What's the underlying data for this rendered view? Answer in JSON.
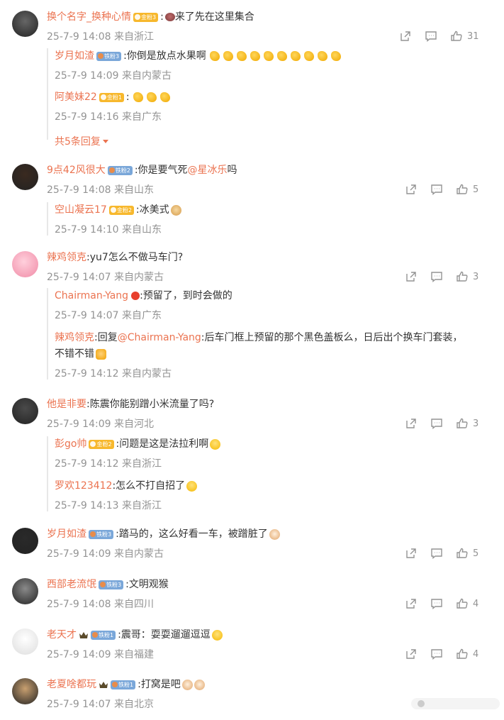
{
  "comments": [
    {
      "user": "换个名字_换种心情",
      "badge": {
        "type": "gold",
        "label": "金粉3"
      },
      "text": "来了先在这里集合",
      "prefix_emoji": "squirrel",
      "suffix_emojis": [],
      "meta": "25-7-9 14:08 来自浙江",
      "likes": "31",
      "avatar_color": "#666",
      "replies": [
        {
          "user": "岁月如渣",
          "badge": {
            "type": "iron",
            "label": "铁粉3"
          },
          "text": "你倒是放点水果啊",
          "suffix_emojis": [
            "banana",
            "banana",
            "banana",
            "banana",
            "banana",
            "banana",
            "banana",
            "banana",
            "banana",
            "banana"
          ],
          "meta": "25-7-9 14:09 来自内蒙古"
        },
        {
          "user": "阿美妹22",
          "badge": {
            "type": "gold",
            "label": "金粉1"
          },
          "text": "",
          "suffix_emojis": [
            "banana",
            "banana",
            "banana"
          ],
          "meta": "25-7-9 14:16 来自广东"
        }
      ],
      "more": "共5条回复"
    },
    {
      "user": "9点42风很大",
      "badge": {
        "type": "iron",
        "label": "铁粉2"
      },
      "text": "你是要气死",
      "mention": "@星冰乐",
      "text_after": " 吗",
      "meta": "25-7-9 14:08 来自山东",
      "likes": "5",
      "avatar_color": "#3a2a20",
      "replies": [
        {
          "user": "空山凝云17",
          "badge": {
            "type": "gold",
            "label": "金粉2"
          },
          "text": "冰美式",
          "suffix_emojis": [
            "dog"
          ],
          "meta": "25-7-9 14:10 来自山东"
        }
      ]
    },
    {
      "user": "辣鸡领克",
      "text": "yu7怎么不做马车门?",
      "meta": "25-7-9 14:07 来自内蒙古",
      "likes": "3",
      "avatar_color": "#f6b6c8",
      "replies": [
        {
          "user": "Chairman-Yang",
          "verified": true,
          "text": "预留了，到时会做的",
          "meta": "25-7-9 14:07 来自广东"
        },
        {
          "user": "辣鸡领克",
          "text": "回复",
          "mention": "@Chairman-Yang",
          "text_after": ":后车门框上预留的那个黑色盖板么，日后出个换车门套装，",
          "text_line2": "不错不错",
          "suffix_emojis": [
            "thumb"
          ],
          "meta": "25-7-9 14:12 来自内蒙古"
        }
      ]
    },
    {
      "user": "他是非要",
      "text": "陈震你能别蹭小米流量了吗?",
      "meta": "25-7-9 14:09 来自河北",
      "likes": "3",
      "avatar_color": "#4a4a4a",
      "replies": [
        {
          "user": "彭go帅",
          "badge": {
            "type": "gold",
            "label": "金粉2"
          },
          "text": "问题是这是法拉利啊",
          "suffix_emojis": [
            "laugh"
          ],
          "meta": "25-7-9 14:12 来自浙江"
        },
        {
          "user": "罗欢123412",
          "text": "怎么不打自招了",
          "suffix_emojis": [
            "laugh"
          ],
          "meta": "25-7-9 14:13 来自浙江"
        }
      ]
    },
    {
      "user": "岁月如渣",
      "badge": {
        "type": "iron",
        "label": "铁粉3"
      },
      "text": "踏马的，这么好看一车，被蹭脏了",
      "suffix_emojis": [
        "cat"
      ],
      "meta": "25-7-9 14:09 来自内蒙古",
      "likes": "5",
      "avatar_color": "#2a2a2a",
      "replies": []
    },
    {
      "user": "西部老流氓",
      "badge": {
        "type": "iron",
        "label": "铁粉3"
      },
      "text": "文明观猴",
      "meta": "25-7-9 14:08 来自四川",
      "likes": "4",
      "avatar_color": "#8a8a8a",
      "replies": []
    },
    {
      "user": "老天才",
      "crown": true,
      "badge": {
        "type": "iron",
        "label": "铁粉1"
      },
      "text": "震哥：耍耍遛遛逗逗",
      "suffix_emojis": [
        "laugh"
      ],
      "meta": "25-7-9 14:09 来自福建",
      "likes": "4",
      "avatar_color": "#f2f2f2",
      "replies": []
    },
    {
      "user": "老夏啥都玩",
      "crown": true,
      "badge": {
        "type": "iron",
        "label": "铁粉1"
      },
      "text": "打窝是吧",
      "suffix_emojis": [
        "cat",
        "cat"
      ],
      "meta": "25-7-9 14:07 来自北京",
      "likes": "",
      "avatar_color": "#c9a070",
      "replies": []
    }
  ],
  "colors": {
    "name": "#eb7350",
    "meta": "#939393",
    "text": "#333333",
    "icon": "#939393"
  }
}
